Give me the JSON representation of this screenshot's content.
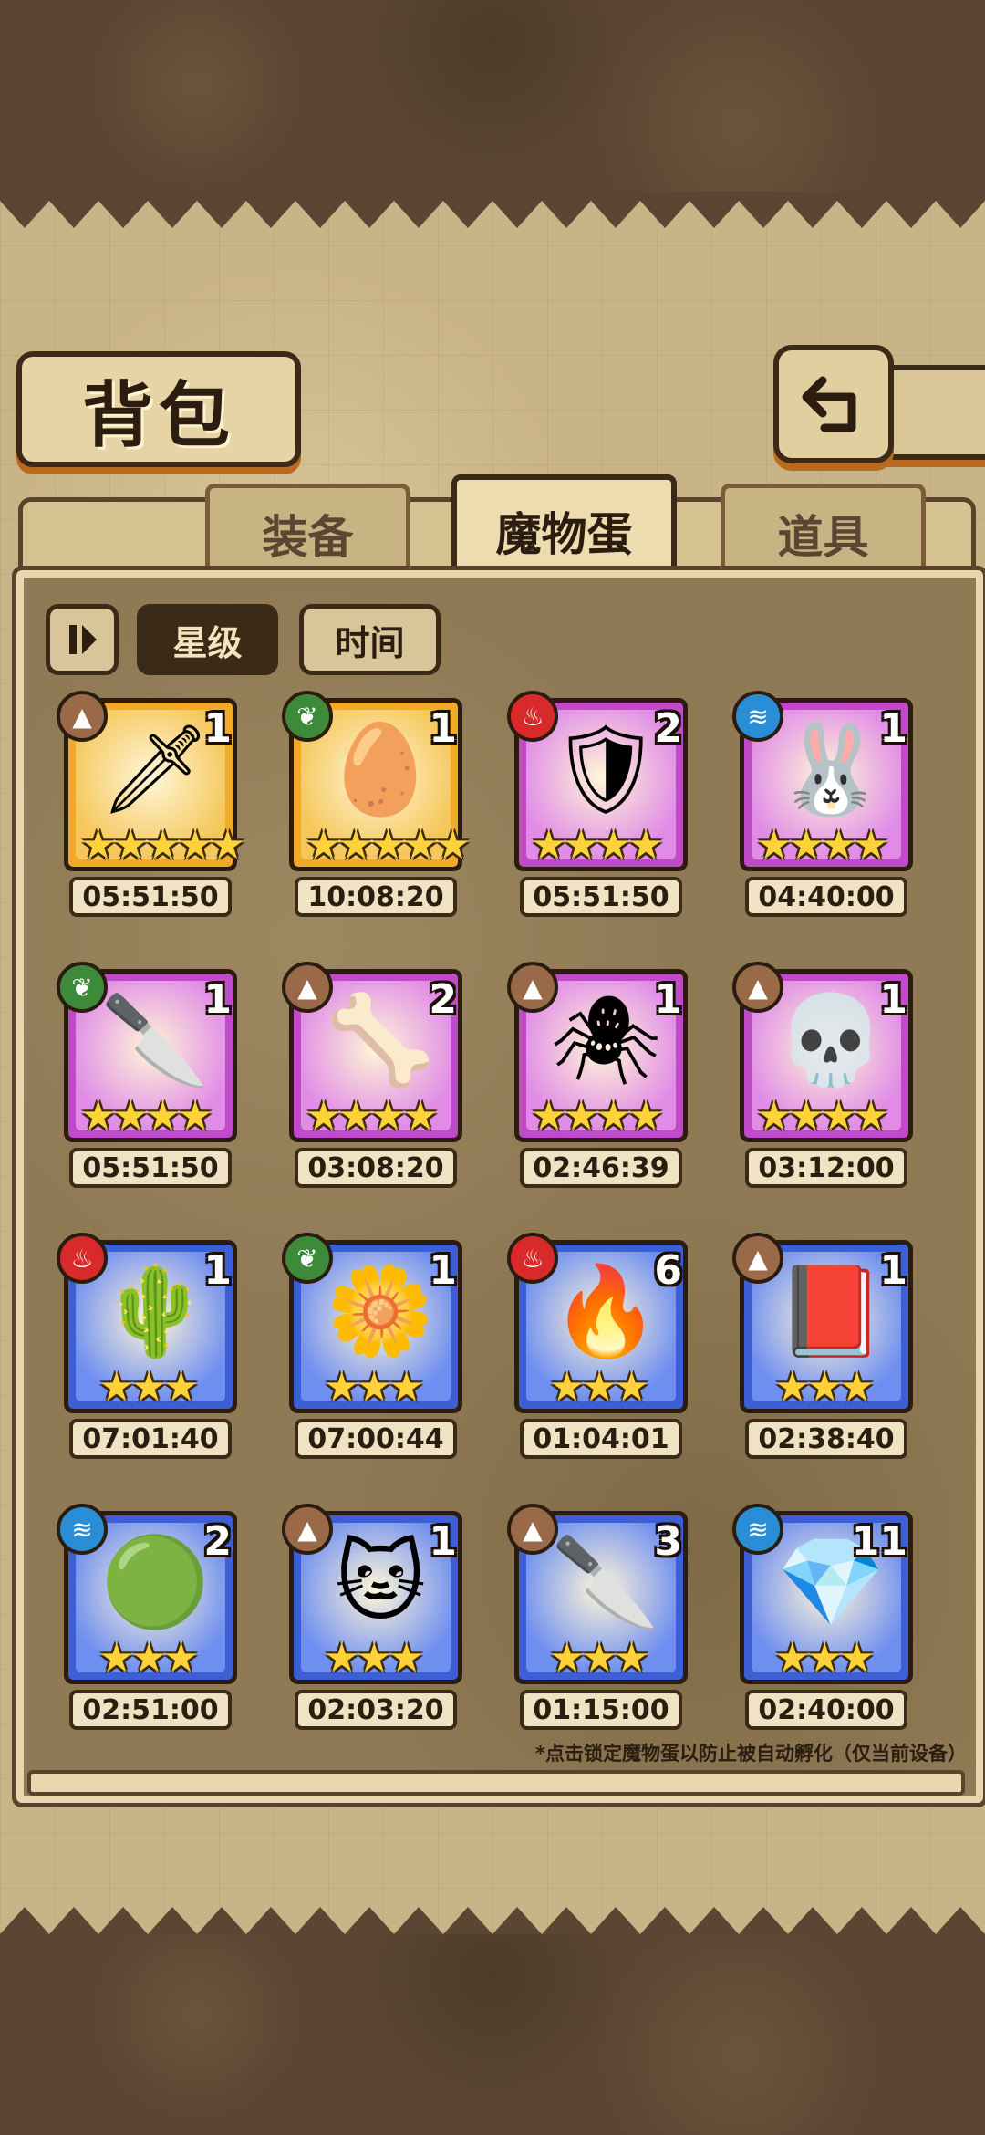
{
  "header": {
    "title": "背包"
  },
  "tabs": [
    {
      "label": "装备",
      "active": false
    },
    {
      "label": "魔物蛋",
      "active": true
    },
    {
      "label": "道具",
      "active": false
    }
  ],
  "sort": {
    "toggle_icon": "sort-toggle-icon",
    "star_label": "星级",
    "time_label": "时间",
    "active": "星级"
  },
  "colors": {
    "gold": "#f0a928",
    "purple": "#c04ac8",
    "blue": "#3d5fd6",
    "earth": "#9a6a48",
    "plant": "#3d8a3a",
    "fire": "#d82a2a",
    "water": "#2a8ed6"
  },
  "eggs": [
    {
      "count": "1",
      "stars": 5,
      "timer": "05:51:50",
      "rarity": "gold",
      "element": "earth",
      "icon": "sword-egg-icon"
    },
    {
      "count": "1",
      "stars": 5,
      "timer": "10:08:20",
      "rarity": "gold",
      "element": "plant",
      "icon": "crystal-egg-icon"
    },
    {
      "count": "2",
      "stars": 4,
      "timer": "05:51:50",
      "rarity": "purple",
      "element": "fire",
      "icon": "shield-egg-icon"
    },
    {
      "count": "1",
      "stars": 4,
      "timer": "04:40:00",
      "rarity": "purple",
      "element": "water",
      "icon": "rabbit-egg-icon"
    },
    {
      "count": "1",
      "stars": 4,
      "timer": "05:51:50",
      "rarity": "purple",
      "element": "plant",
      "icon": "kunai-egg-icon"
    },
    {
      "count": "2",
      "stars": 4,
      "timer": "03:08:20",
      "rarity": "purple",
      "element": "earth",
      "icon": "horn-egg-icon"
    },
    {
      "count": "1",
      "stars": 4,
      "timer": "02:46:39",
      "rarity": "purple",
      "element": "earth",
      "icon": "spider-egg-icon"
    },
    {
      "count": "1",
      "stars": 4,
      "timer": "03:12:00",
      "rarity": "purple",
      "element": "earth",
      "icon": "skull-egg-icon"
    },
    {
      "count": "1",
      "stars": 3,
      "timer": "07:01:40",
      "rarity": "blue",
      "element": "fire",
      "icon": "cactus-egg-icon"
    },
    {
      "count": "1",
      "stars": 3,
      "timer": "07:00:44",
      "rarity": "blue",
      "element": "plant",
      "icon": "bud-egg-icon"
    },
    {
      "count": "6",
      "stars": 3,
      "timer": "01:04:01",
      "rarity": "blue",
      "element": "fire",
      "icon": "flame-egg-icon"
    },
    {
      "count": "1",
      "stars": 3,
      "timer": "02:38:40",
      "rarity": "blue",
      "element": "earth",
      "icon": "book-egg-icon"
    },
    {
      "count": "2",
      "stars": 3,
      "timer": "02:51:00",
      "rarity": "blue",
      "element": "water",
      "icon": "slime-egg-icon"
    },
    {
      "count": "1",
      "stars": 3,
      "timer": "02:03:20",
      "rarity": "blue",
      "element": "earth",
      "icon": "cat-egg-icon"
    },
    {
      "count": "3",
      "stars": 3,
      "timer": "01:15:00",
      "rarity": "blue",
      "element": "earth",
      "icon": "cleaver-egg-icon"
    },
    {
      "count": "11",
      "stars": 3,
      "timer": "02:40:00",
      "rarity": "blue",
      "element": "water",
      "icon": "ice-egg-icon"
    }
  ],
  "footnote": "*点击锁定魔物蛋以防止被自动孵化（仅当前设备）"
}
